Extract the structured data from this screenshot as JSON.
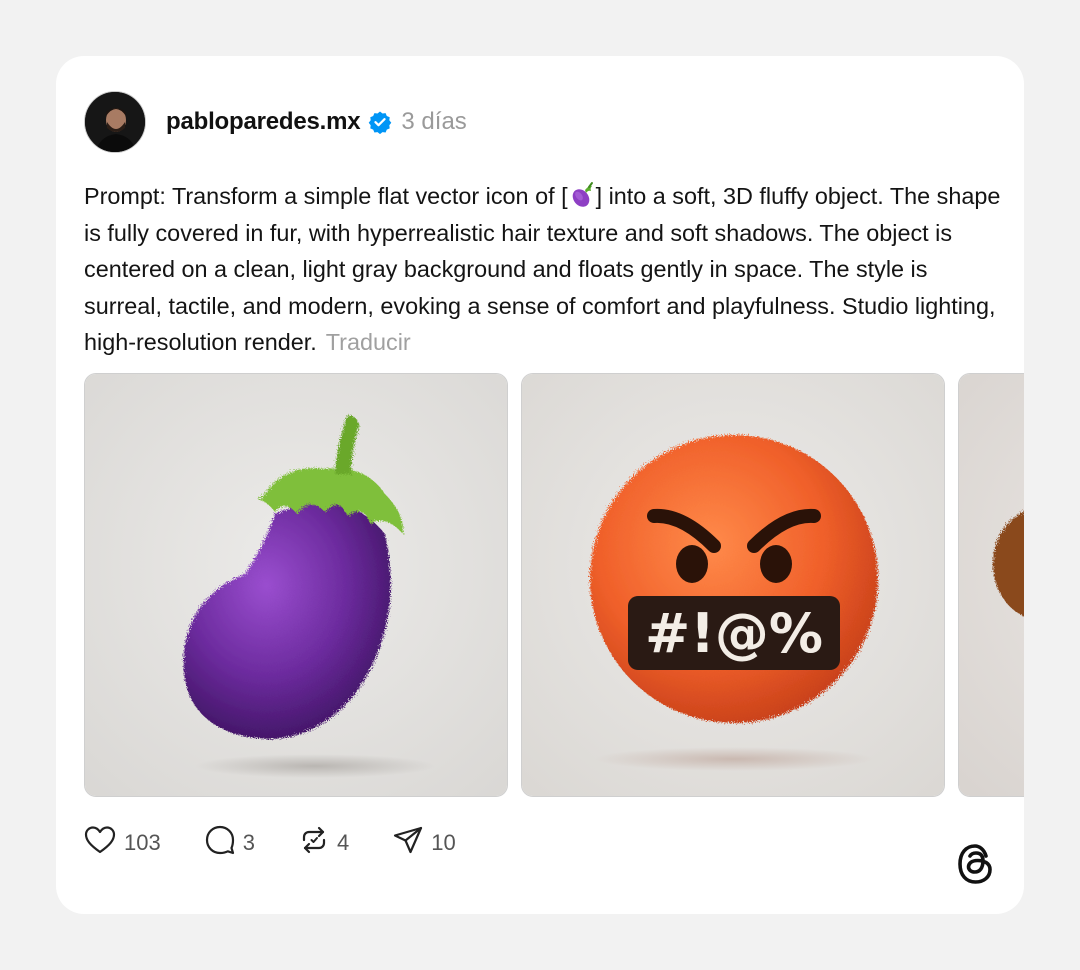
{
  "post": {
    "username": "pabloparedes.mx",
    "time": "3 días",
    "text_before": "Prompt: Transform a simple flat vector icon of [",
    "text_after": "] into a soft, 3D fluffy object. The shape is fully covered in fur, with hyperrealistic hair texture and soft shadows. The object is centered on a clean, light gray background and floats gently in space. The style is surreal, tactile, and modern, evoking a sense of comfort and playfulness. Studio lighting, high-resolution render.",
    "translate_label": "Traducir"
  },
  "gallery": {
    "images": [
      {
        "subject": "fluffy purple eggplant"
      },
      {
        "subject": "fluffy orange angry face",
        "symbols": "#!@%"
      },
      {
        "subject": "fluffy brown object (partially visible)"
      }
    ]
  },
  "actions": {
    "likes": "103",
    "replies": "3",
    "reposts": "4",
    "shares": "10"
  },
  "colors": {
    "verified": "#0095f6",
    "muted": "#9a9a9a",
    "eggplant": "#6c2b9e",
    "angry": "#f0602a"
  },
  "icons": [
    "verified-badge-icon",
    "heart-icon",
    "comment-icon",
    "repost-icon",
    "share-icon",
    "threads-logo-icon"
  ]
}
